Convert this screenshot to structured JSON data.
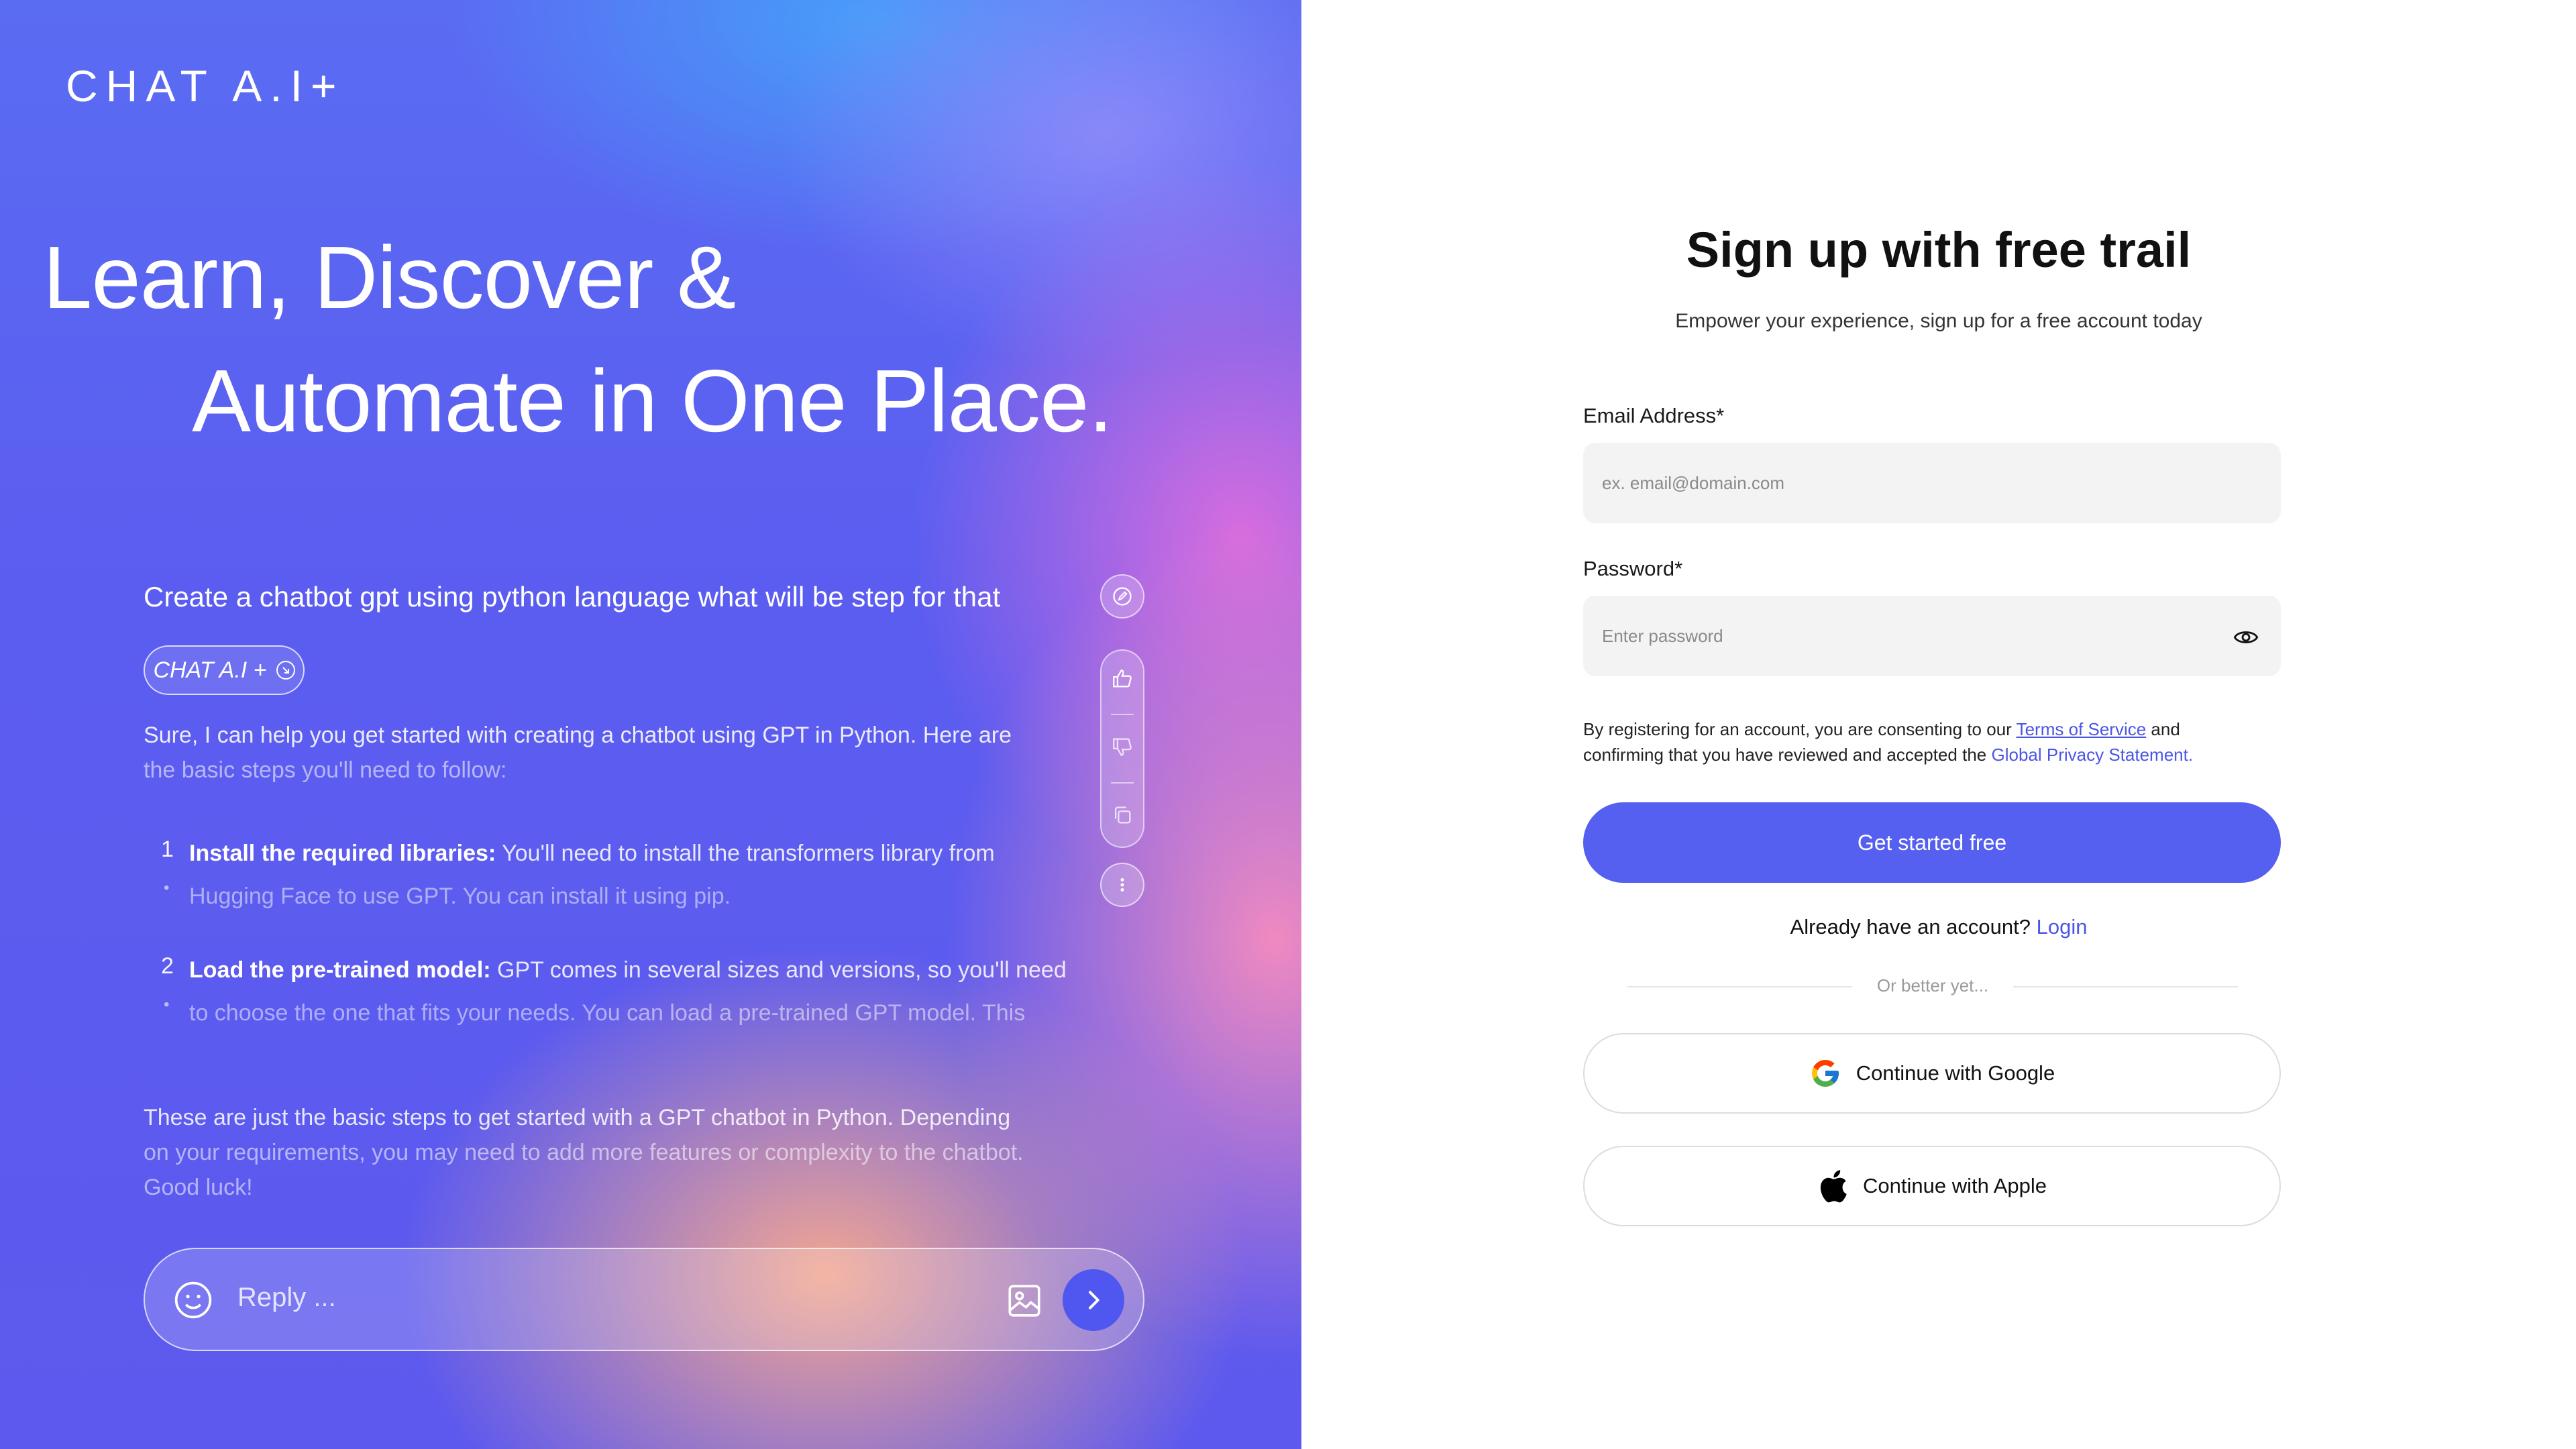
{
  "brand": {
    "logo": "CHAT A.I+"
  },
  "hero": {
    "line1": "Learn, Discover &",
    "line2": "Automate in One Place."
  },
  "chat": {
    "question": "Create a chatbot gpt using python language what will be step for that",
    "chip_label": "CHAT A.I +",
    "answer_intro_a": "Sure, I can help you get started with creating a chatbot using GPT in Python. Here are",
    "answer_intro_b": "the basic steps you'll need to follow:",
    "steps": [
      {
        "num": "1",
        "title": "Install the required libraries:",
        "text_a": " You'll need to install the transformers library from",
        "text_b": "Hugging Face to use GPT. You can install it using pip."
      },
      {
        "num": "2",
        "title": "Load the pre-trained model:",
        "text_a": " GPT comes in several sizes and versions, so you'll need",
        "text_b": "to choose the one that fits your needs. You can load a pre-trained GPT model. This"
      }
    ],
    "closing_a": "These are just the basic steps to get started with a GPT chatbot in Python. Depending",
    "closing_b": "on your requirements, you may need to add more features or complexity to the chatbot.",
    "closing_c": "Good luck!",
    "reply_placeholder": "Reply ..."
  },
  "signup": {
    "title": "Sign up with free trail",
    "subtitle": "Empower your experience, sign up for a free account today",
    "email_label": "Email Address*",
    "email_placeholder": "ex. email@domain.com",
    "password_label": "Password*",
    "password_placeholder": "Enter password",
    "consent_a": "By registering for an account, you are consenting to our ",
    "terms_link": "Terms of Service",
    "consent_b": " and",
    "consent_c": "confirming that you have reviewed and accepted the ",
    "privacy_link": "Global Privacy Statement.",
    "primary_button": "Get started free",
    "have_account": "Already have an account? ",
    "login_link": "Login",
    "divider_text": "Or better yet...",
    "google_button": "Continue with Google",
    "apple_button": "Continue with Apple"
  },
  "colors": {
    "primary": "#5560f0",
    "link": "#4b55e6",
    "input_bg": "#f3f3f4"
  },
  "icons": [
    "edit-icon",
    "thumbs-up-icon",
    "thumbs-down-icon",
    "copy-icon",
    "more-vertical-icon",
    "emoji-icon",
    "image-icon",
    "chevron-right-icon",
    "eye-icon",
    "google-icon",
    "apple-icon",
    "arrow-circle-icon"
  ]
}
